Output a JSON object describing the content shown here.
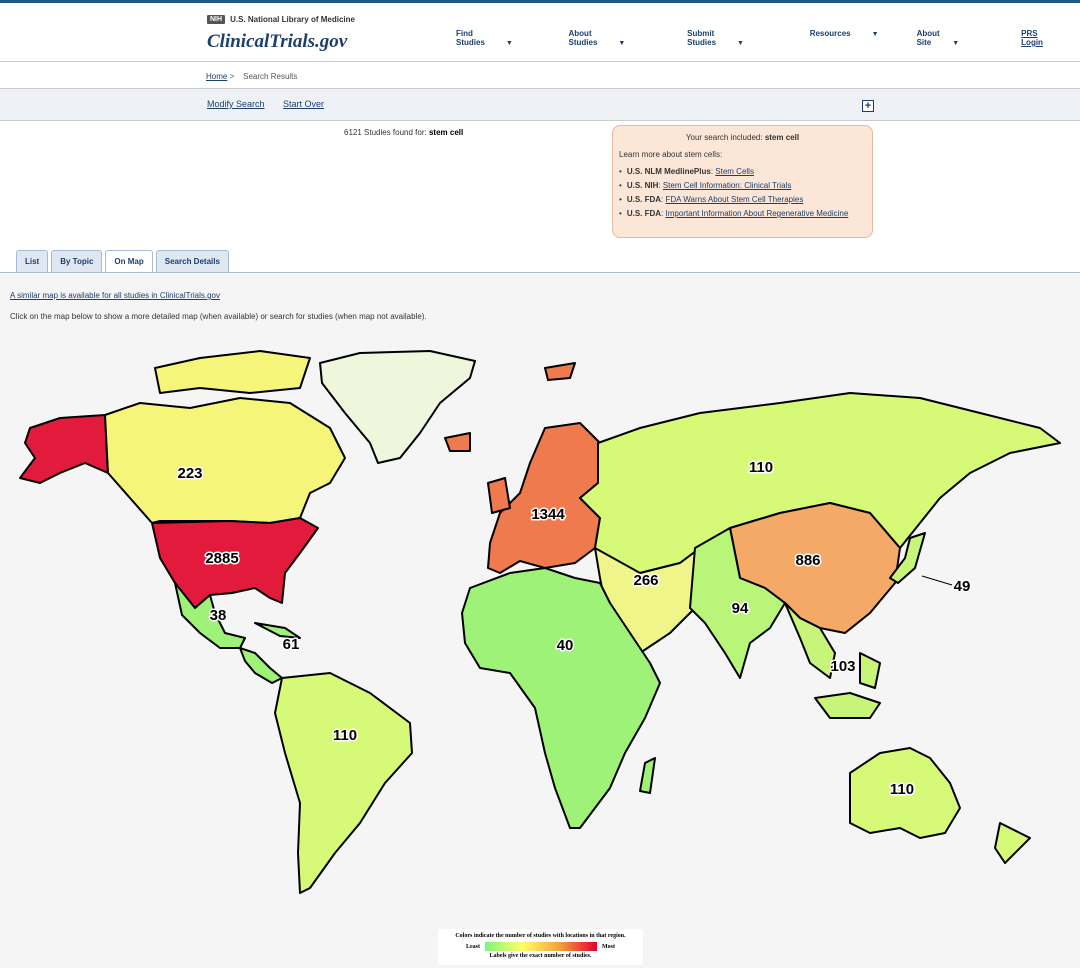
{
  "header": {
    "agency": "U.S. National Library of Medicine",
    "agency_badge": "NIH",
    "site": "ClinicalTrials.gov",
    "nav": [
      "Find Studies",
      "About Studies",
      "Submit Studies",
      "Resources",
      "About Site"
    ],
    "login": "PRS Login"
  },
  "breadcrumb": {
    "home": "Home",
    "sep": ">",
    "current": "Search Results"
  },
  "toolbar": {
    "modify": "Modify Search",
    "start_over": "Start Over",
    "expand": "+"
  },
  "results": {
    "prefix": "6121 Studies found for:",
    "query": "stem cell"
  },
  "info_box": {
    "title_prefix": "Your search included:",
    "title_term": "stem cell",
    "learn": "Learn more about stem cells:",
    "items": [
      {
        "source": "U.S. NLM MedlinePlus",
        "link": "Stem Cells"
      },
      {
        "source": "U.S. NIH",
        "link": "Stem Cell Information: Clinical Trials"
      },
      {
        "source": "U.S. FDA",
        "link": "FDA Warns About Stem Cell Therapies"
      },
      {
        "source": "U.S. FDA",
        "link": "Important Information About Regenerative Medicine"
      }
    ]
  },
  "tabs": [
    "List",
    "By Topic",
    "On Map",
    "Search Details"
  ],
  "active_tab": "On Map",
  "map": {
    "similar": "A similar map is available for all studies in ClinicalTrials.gov",
    "instruction": "Click on the map below to show a more detailed map (when available) or search for studies (when map not available).",
    "regions": [
      {
        "name": "Canada",
        "count": "223",
        "color": "#f5f57a"
      },
      {
        "name": "United States",
        "count": "2885",
        "color": "#e21a3c"
      },
      {
        "name": "Alaska",
        "count": "",
        "color": "#e21a3c"
      },
      {
        "name": "Mexico",
        "count": "38",
        "color": "#9ef278"
      },
      {
        "name": "Central America",
        "count": "61",
        "color": "#9ef278"
      },
      {
        "name": "South America",
        "count": "110",
        "color": "#d6fa78"
      },
      {
        "name": "Europe",
        "count": "1344",
        "color": "#ef7a4e"
      },
      {
        "name": "Africa",
        "count": "40",
        "color": "#9ef278"
      },
      {
        "name": "Middle East",
        "count": "266",
        "color": "#f0f58a"
      },
      {
        "name": "Russia",
        "count": "110",
        "color": "#d6fa78"
      },
      {
        "name": "East Asia",
        "count": "886",
        "color": "#f4aa66"
      },
      {
        "name": "Japan",
        "count": "49",
        "color": "#c7f57a"
      },
      {
        "name": "South Asia",
        "count": "94",
        "color": "#b8f578"
      },
      {
        "name": "Southeast Asia",
        "count": "103",
        "color": "#c7f57a"
      },
      {
        "name": "Oceania",
        "count": "110",
        "color": "#d6fa78"
      },
      {
        "name": "Greenland",
        "count": "",
        "color": "#eef7dc"
      }
    ],
    "legend": {
      "title": "Colors indicate the number of studies with locations in that region.",
      "least": "Least",
      "most": "Most",
      "note": "Labels give the exact number of studies."
    }
  }
}
